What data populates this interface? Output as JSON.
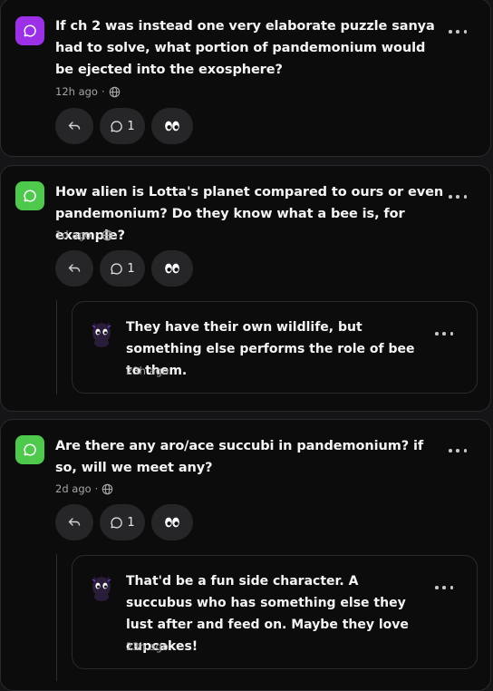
{
  "colors": {
    "icon_purple": "#9b30e6",
    "icon_green": "#4ec94e",
    "card_bg": "#0c0c0d",
    "button_bg": "#262628"
  },
  "questions": [
    {
      "text": "If ch 2 was instead one very elaborate puzzle sanya had to solve, what portion of pandemonium would be ejected into the exosphere?",
      "time": "12h ago",
      "comment_count": "1",
      "icon": "chat-bubble-icon"
    },
    {
      "text": "How alien is Lotta's planet compared to ours or even pandemonium? Do they know what a bee is, for example?",
      "time": "1d ago",
      "comment_count": "1",
      "icon": "chat-bubble-icon",
      "reply": {
        "text": "They have their own wildlife, but something else performs the role of bee to them.",
        "time": "23h ago"
      }
    },
    {
      "text": "Are there any aro/ace succubi in pandemonium? if so, will we meet any?",
      "time": "2d ago",
      "comment_count": "1",
      "icon": "chat-bubble-icon",
      "reply": {
        "text": "That'd be a fun side character. A succubus who has something else they lust after and feed on. Maybe they love cupcakes!",
        "time": "23h ago"
      }
    }
  ]
}
